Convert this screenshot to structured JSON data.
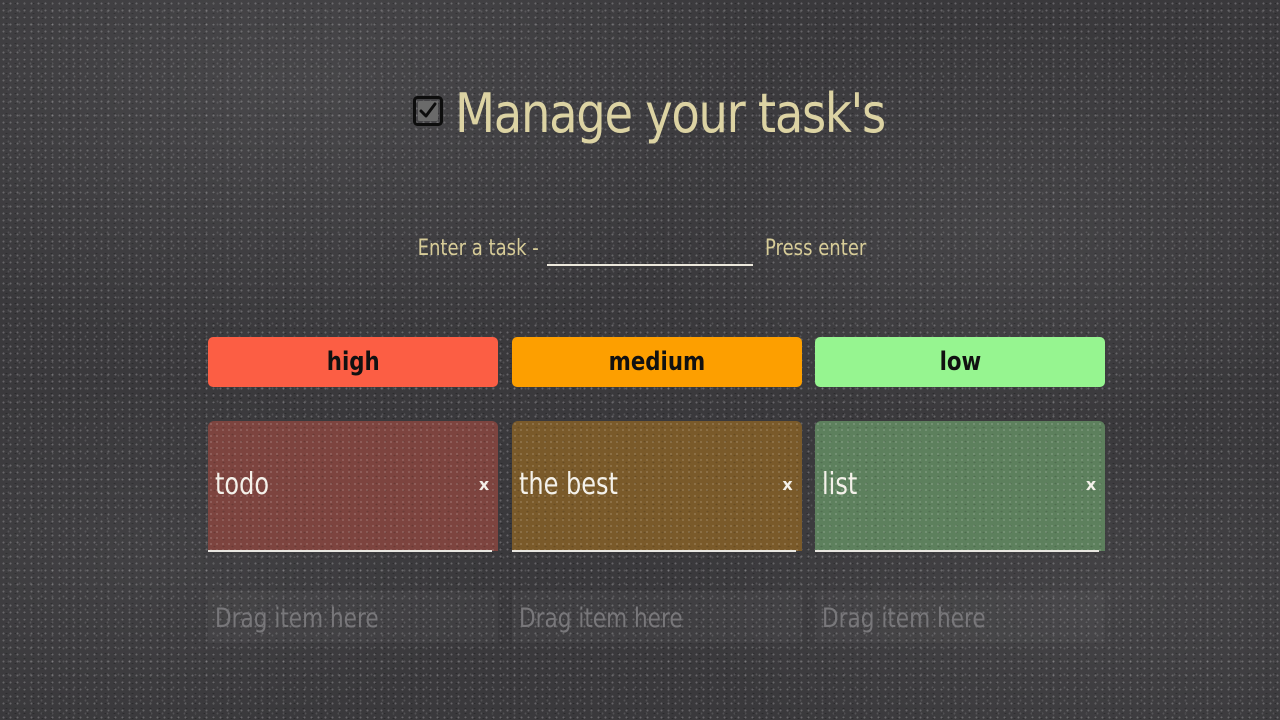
{
  "header": {
    "icon": "checked-checkbox-icon",
    "title": "Manage your task's"
  },
  "entry": {
    "label": "Enter a task -",
    "input_value": "",
    "input_placeholder": "",
    "hint": "Press enter"
  },
  "columns": [
    {
      "header": "high",
      "header_color": "#fc5e44",
      "card_color": "#7d443f",
      "task": "todo",
      "delete_label": "x",
      "drop_hint": "Drag item here"
    },
    {
      "header": "medium",
      "header_color": "#fd9f00",
      "card_color": "#7a5a2a",
      "task": "the best",
      "delete_label": "x",
      "drop_hint": "Drag item here"
    },
    {
      "header": "low",
      "header_color": "#96f590",
      "card_color": "#5d805d",
      "task": "list",
      "delete_label": "x",
      "drop_hint": "Drag item here"
    }
  ],
  "colors": {
    "title_text": "#dcd3a3",
    "board_background": "#3a393c",
    "drop_hint_text": "#78777a"
  }
}
